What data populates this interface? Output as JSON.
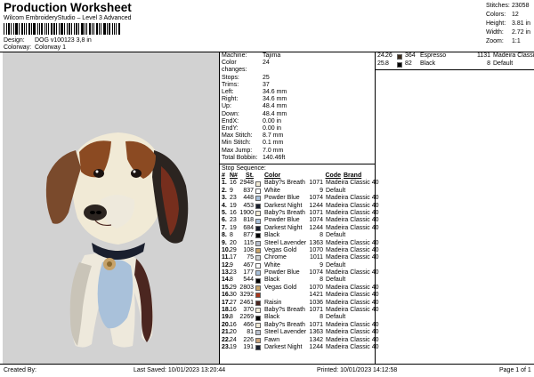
{
  "header": {
    "title": "Production Worksheet",
    "subtitle": "Wilcom EmbroideryStudio – Level 3 Advanced",
    "design_label": "Design:",
    "design_value": "DOG v100123 3,8 in",
    "colorway_label": "Colorway:",
    "colorway_value": "Colorway 1"
  },
  "stats": [
    {
      "k": "Stitches:",
      "v": "23058"
    },
    {
      "k": "Colors:",
      "v": "12"
    },
    {
      "k": "Height:",
      "v": "3.81 in"
    },
    {
      "k": "Width:",
      "v": "2.72 in"
    },
    {
      "k": "Zoom:",
      "v": "1:1"
    }
  ],
  "machine": [
    {
      "k": "Machine:",
      "v": "Tajima"
    },
    {
      "k": "Color changes:",
      "v": "24"
    },
    {
      "k": "Stops:",
      "v": "25"
    },
    {
      "k": "Trims:",
      "v": "37"
    },
    {
      "k": "Left:",
      "v": "34.6 mm"
    },
    {
      "k": "Right:",
      "v": "34.6 mm"
    },
    {
      "k": "Up:",
      "v": "48.4 mm"
    },
    {
      "k": "Down:",
      "v": "48.4 mm"
    },
    {
      "k": "EndX:",
      "v": "0.00 in"
    },
    {
      "k": "EndY:",
      "v": "0.00 in"
    },
    {
      "k": "Max Stitch:",
      "v": "8.7 mm"
    },
    {
      "k": "Min Stitch:",
      "v": "0.1 mm"
    },
    {
      "k": "Max Jump:",
      "v": "7.0 mm"
    },
    {
      "k": "Total Bobbin:",
      "v": "140.46ft"
    }
  ],
  "stop_sequence_label": "Stop Sequence:",
  "stop_headers": {
    "no": "#",
    "n": "N#",
    "st": "St.",
    "color": "Color",
    "code": "Code",
    "brand": "Brand"
  },
  "stops": [
    {
      "no": "1.",
      "n": "16",
      "st": "2948",
      "swatch": "#f1ead6",
      "name": "Baby?s Breath",
      "code": "1071",
      "brand": "Madeira Classic 40"
    },
    {
      "no": "2.",
      "n": "9",
      "st": "837",
      "swatch": "#ffffff",
      "name": "White",
      "code": "9",
      "brand": "Default"
    },
    {
      "no": "3.",
      "n": "23",
      "st": "448",
      "swatch": "#a9c1da",
      "name": "Powder Blue",
      "code": "1074",
      "brand": "Madeira Classic 40"
    },
    {
      "no": "4.",
      "n": "19",
      "st": "453",
      "swatch": "#1a1f2e",
      "name": "Darkest Night",
      "code": "1244",
      "brand": "Madeira Classic 40"
    },
    {
      "no": "5.",
      "n": "16",
      "st": "1900",
      "swatch": "#f1ead6",
      "name": "Baby?s Breath",
      "code": "1071",
      "brand": "Madeira Classic 40"
    },
    {
      "no": "6.",
      "n": "23",
      "st": "818",
      "swatch": "#a9c1da",
      "name": "Powder Blue",
      "code": "1074",
      "brand": "Madeira Classic 40"
    },
    {
      "no": "7.",
      "n": "19",
      "st": "684",
      "swatch": "#1a1f2e",
      "name": "Darkest Night",
      "code": "1244",
      "brand": "Madeira Classic 40"
    },
    {
      "no": "8.",
      "n": "8",
      "st": "877",
      "swatch": "#000000",
      "name": "Black",
      "code": "8",
      "brand": "Default"
    },
    {
      "no": "9.",
      "n": "20",
      "st": "115",
      "swatch": "#b9c0cd",
      "name": "Steel Lavender",
      "code": "1363",
      "brand": "Madeira Classic 40"
    },
    {
      "no": "10.",
      "n": "29",
      "st": "108",
      "swatch": "#c7a36a",
      "name": "Vegas Gold",
      "code": "1070",
      "brand": "Madeira Classic 40"
    },
    {
      "no": "11.",
      "n": "17",
      "st": "75",
      "swatch": "#cfd2d4",
      "name": "Chrome",
      "code": "1011",
      "brand": "Madeira Classic 40"
    },
    {
      "no": "12.",
      "n": "9",
      "st": "467",
      "swatch": "#ffffff",
      "name": "White",
      "code": "9",
      "brand": "Default"
    },
    {
      "no": "13.",
      "n": "23",
      "st": "177",
      "swatch": "#a9c1da",
      "name": "Powder Blue",
      "code": "1074",
      "brand": "Madeira Classic 40"
    },
    {
      "no": "14.",
      "n": "8",
      "st": "544",
      "swatch": "#000000",
      "name": "Black",
      "code": "8",
      "brand": "Default"
    },
    {
      "no": "15.",
      "n": "29",
      "st": "2803",
      "swatch": "#c7a36a",
      "name": "Vegas Gold",
      "code": "1070",
      "brand": "Madeira Classic 40"
    },
    {
      "no": "16.",
      "n": "30",
      "st": "3292",
      "swatch": "#a8361c",
      "name": "",
      "code": "1421",
      "brand": "Madeira Classic 40"
    },
    {
      "no": "17.",
      "n": "27",
      "st": "2461",
      "swatch": "#4b2620",
      "name": "Raisin",
      "code": "1036",
      "brand": "Madeira Classic 40"
    },
    {
      "no": "18.",
      "n": "16",
      "st": "370",
      "swatch": "#f1ead6",
      "name": "Baby?s Breath",
      "code": "1071",
      "brand": "Madeira Classic 40"
    },
    {
      "no": "19.",
      "n": "8",
      "st": "2269",
      "swatch": "#000000",
      "name": "Black",
      "code": "8",
      "brand": "Default"
    },
    {
      "no": "20.",
      "n": "16",
      "st": "466",
      "swatch": "#f1ead6",
      "name": "Baby?s Breath",
      "code": "1071",
      "brand": "Madeira Classic 40"
    },
    {
      "no": "21.",
      "n": "20",
      "st": "81",
      "swatch": "#b9c0cd",
      "name": "Steel Lavender",
      "code": "1363",
      "brand": "Madeira Classic 40"
    },
    {
      "no": "22.",
      "n": "24",
      "st": "226",
      "swatch": "#c9a27a",
      "name": "Fawn",
      "code": "1342",
      "brand": "Madeira Classic 40"
    },
    {
      "no": "23.",
      "n": "19",
      "st": "191",
      "swatch": "#1a1f2e",
      "name": "Darkest Night",
      "code": "1244",
      "brand": "Madeira Classic 40"
    }
  ],
  "stops_right": [
    {
      "no": "24.",
      "n": "26",
      "st": "364",
      "swatch": "#3a2a1c",
      "name": "Espresso",
      "code": "1131",
      "brand": "Madeira Classic 40"
    },
    {
      "no": "25.",
      "n": "8",
      "st": "82",
      "swatch": "#000000",
      "name": "Black",
      "code": "8",
      "brand": "Default"
    }
  ],
  "footer": {
    "created_by": "Created By:",
    "last_saved": "Last Saved: 10/01/2023 13:20:44",
    "printed": "Printed: 10/01/2023 14:12:58",
    "page": "Page 1 of 1"
  }
}
